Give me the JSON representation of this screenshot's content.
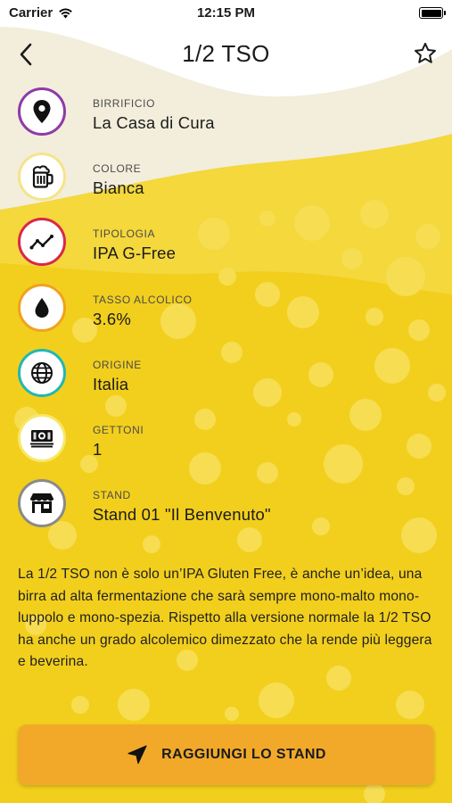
{
  "status_bar": {
    "carrier": "Carrier",
    "time": "12:15 PM"
  },
  "nav": {
    "title": "1/2 TSO"
  },
  "details": [
    {
      "label": "BIRRIFICIO",
      "value": "La Casa di Cura",
      "icon": "location-pin-icon",
      "ring_color": "#8e3aa8"
    },
    {
      "label": "COLORE",
      "value": "Bianca",
      "icon": "beer-mug-icon",
      "ring_color": "#f5e48a"
    },
    {
      "label": "TIPOLOGIA",
      "value": "IPA G-Free",
      "icon": "trend-line-icon",
      "ring_color": "#d8284a"
    },
    {
      "label": "TASSO ALCOLICO",
      "value": "3.6%",
      "icon": "drop-icon",
      "ring_color": "#f0a21f"
    },
    {
      "label": "ORIGINE",
      "value": "Italia",
      "icon": "globe-icon",
      "ring_color": "#23b7b3"
    },
    {
      "label": "GETTONI",
      "value": "1",
      "icon": "money-icon",
      "ring_color": "#f7e86a"
    },
    {
      "label": "STAND",
      "value": "Stand 01 \"Il Benvenuto\"",
      "icon": "store-icon",
      "ring_color": "#8a8a8a"
    }
  ],
  "description": "La 1/2 TSO non è solo un’IPA Gluten Free, è anche un’idea, una birra ad alta fermentazione che sarà sempre mono-malto mono-luppolo e mono-spezia. Rispetto alla versione normale la 1/2 TSO ha anche un grado alcolemico dimezzato che la rende più leggera e beverina.",
  "cta": {
    "label": "RAGGIUNGI LO STAND",
    "icon": "navigation-arrow-icon",
    "color": "#f2a92a"
  },
  "colors": {
    "beer_yellow": "#f2cf1d",
    "foam": "#f3efdd",
    "bubble": "#f7dc4f"
  }
}
